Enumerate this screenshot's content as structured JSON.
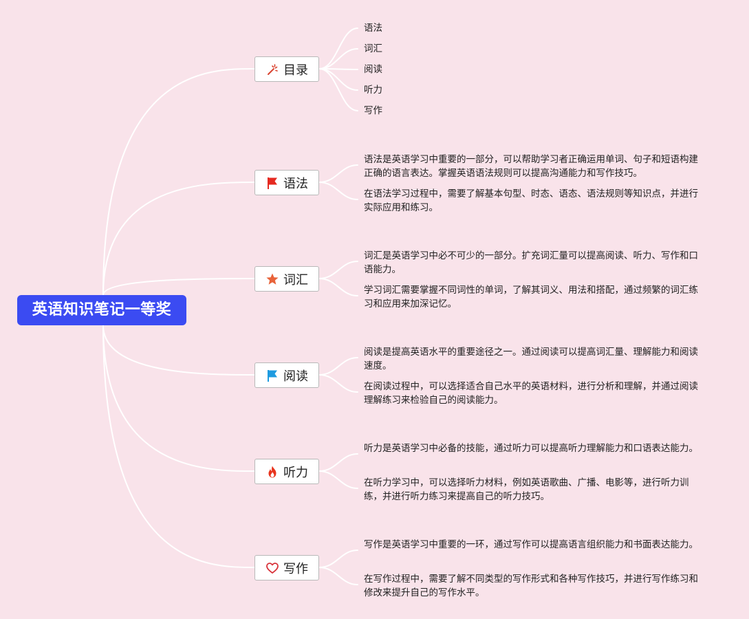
{
  "root": {
    "title": "英语知识笔记一等奖"
  },
  "toc": {
    "label": "目录",
    "items": [
      "语法",
      "词汇",
      "阅读",
      "听力",
      "写作"
    ]
  },
  "branches": [
    {
      "label": "语法",
      "icon": "red-flag-icon",
      "paragraphs": [
        "语法是英语学习中重要的一部分，可以帮助学习者正确运用单词、句子和短语构建正确的语言表达。掌握英语语法规则可以提高沟通能力和写作技巧。",
        "在语法学习过程中，需要了解基本句型、时态、语态、语法规则等知识点，并进行实际应用和练习。"
      ]
    },
    {
      "label": "词汇",
      "icon": "star-icon",
      "paragraphs": [
        "词汇是英语学习中必不可少的一部分。扩充词汇量可以提高阅读、听力、写作和口语能力。",
        "学习词汇需要掌握不同词性的单词，了解其词义、用法和搭配，通过频繁的词汇练习和应用来加深记忆。"
      ]
    },
    {
      "label": "阅读",
      "icon": "blue-flag-icon",
      "paragraphs": [
        "阅读是提高英语水平的重要途径之一。通过阅读可以提高词汇量、理解能力和阅读速度。",
        "在阅读过程中，可以选择适合自己水平的英语材料，进行分析和理解，并通过阅读理解练习来检验自己的阅读能力。"
      ]
    },
    {
      "label": "听力",
      "icon": "fire-icon",
      "paragraphs": [
        "听力是英语学习中必备的技能，通过听力可以提高听力理解能力和口语表达能力。",
        "在听力学习中，可以选择听力材料，例如英语歌曲、广播、电影等，进行听力训练，并进行听力练习来提高自己的听力技巧。"
      ]
    },
    {
      "label": "写作",
      "icon": "heart-icon",
      "paragraphs": [
        "写作是英语学习中重要的一环，通过写作可以提高语言组织能力和书面表达能力。",
        "在写作过程中，需要了解不同类型的写作形式和各种写作技巧，并进行写作练习和修改来提升自己的写作水平。"
      ]
    }
  ],
  "colors": {
    "background": "#f9e3ea",
    "root": "#3b4bf2",
    "connector": "#ffffff"
  }
}
